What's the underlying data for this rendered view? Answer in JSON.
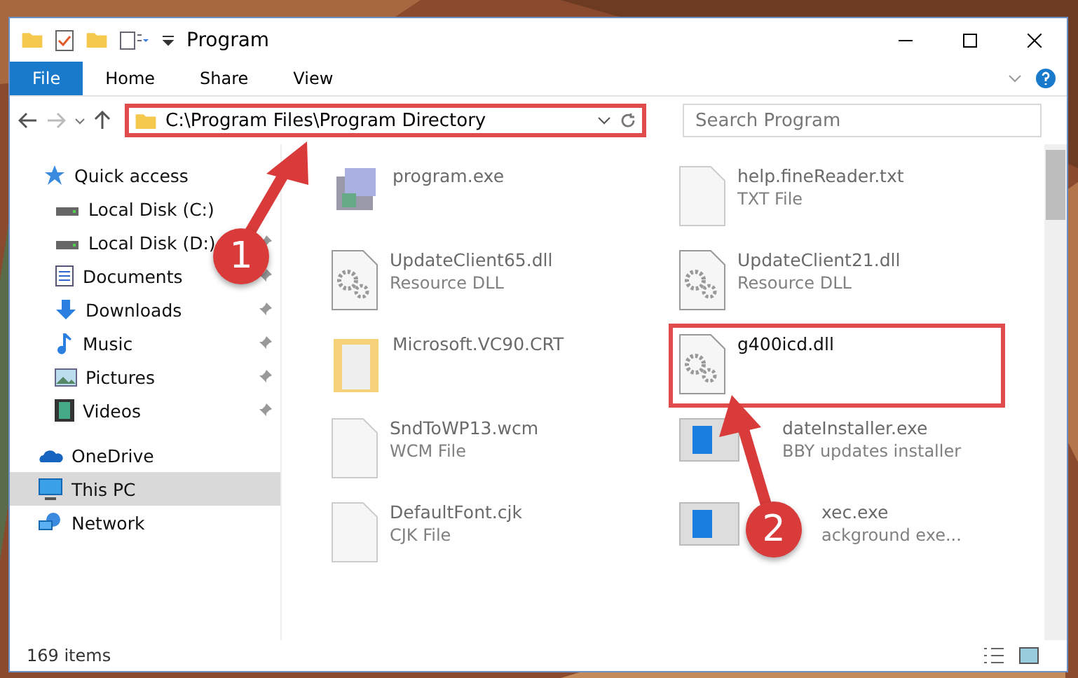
{
  "window": {
    "title": "Program"
  },
  "ribbon_tabs": [
    {
      "label": "File",
      "selected": true
    },
    {
      "label": "Home",
      "selected": false
    },
    {
      "label": "Share",
      "selected": false
    },
    {
      "label": "View",
      "selected": false
    }
  ],
  "address": {
    "path": "C:\\Program Files\\Program Directory",
    "highlighted": true
  },
  "search": {
    "placeholder": "Search Program"
  },
  "sidebar": {
    "items": [
      {
        "label": "Quick access",
        "kind": "star",
        "pinned": false,
        "selected": false,
        "children": [
          {
            "label": "Local Disk (C:)",
            "kind": "disk",
            "pinned": false,
            "selected": false
          },
          {
            "label": "Local Disk (D:)",
            "kind": "disk",
            "pinned": true,
            "selected": false
          },
          {
            "label": "Documents",
            "kind": "docs",
            "pinned": true,
            "selected": false
          },
          {
            "label": "Downloads",
            "kind": "download",
            "pinned": true,
            "selected": false
          },
          {
            "label": "Music",
            "kind": "music",
            "pinned": true,
            "selected": false
          },
          {
            "label": "Pictures",
            "kind": "pictures",
            "pinned": true,
            "selected": false
          },
          {
            "label": "Videos",
            "kind": "videos",
            "pinned": true,
            "selected": false
          }
        ]
      },
      {
        "label": "OneDrive",
        "kind": "cloud",
        "pinned": false,
        "selected": false
      },
      {
        "label": "This PC",
        "kind": "pc",
        "pinned": false,
        "selected": true
      },
      {
        "label": "Network",
        "kind": "network",
        "pinned": false,
        "selected": false
      }
    ]
  },
  "files": [
    {
      "name": "program.exe",
      "kind": "app",
      "highlighted": false
    },
    {
      "name": "help.fineReader.txt",
      "type": "TXT File",
      "kind": "doc",
      "highlighted": false
    },
    {
      "name": "UpdateClient65.dll",
      "type": "Resource DLL",
      "kind": "dll",
      "highlighted": false
    },
    {
      "name": "UpdateClient21.dll",
      "type": "Resource DLL",
      "kind": "dll",
      "highlighted": false
    },
    {
      "name": "Microsoft.VC90.CRT",
      "kind": "folder",
      "highlighted": false
    },
    {
      "name": "g400icd.dll",
      "kind": "dll",
      "highlighted": true
    },
    {
      "name": "SndToWP13.wcm",
      "type": "WCM File",
      "kind": "doc",
      "highlighted": false
    },
    {
      "name": "dateInstaller.exe",
      "type": "BBY updates installer",
      "kind": "window",
      "highlighted": false,
      "covered": true
    },
    {
      "name": "DefaultFont.cjk",
      "type": "CJK File",
      "kind": "doc",
      "highlighted": false
    },
    {
      "name": "xec.exe",
      "type": "ackground exe...",
      "kind": "window",
      "highlighted": false,
      "covered": true
    }
  ],
  "status_bar": {
    "count": "169 items"
  },
  "callouts": [
    {
      "number": "1"
    },
    {
      "number": "2"
    }
  ]
}
